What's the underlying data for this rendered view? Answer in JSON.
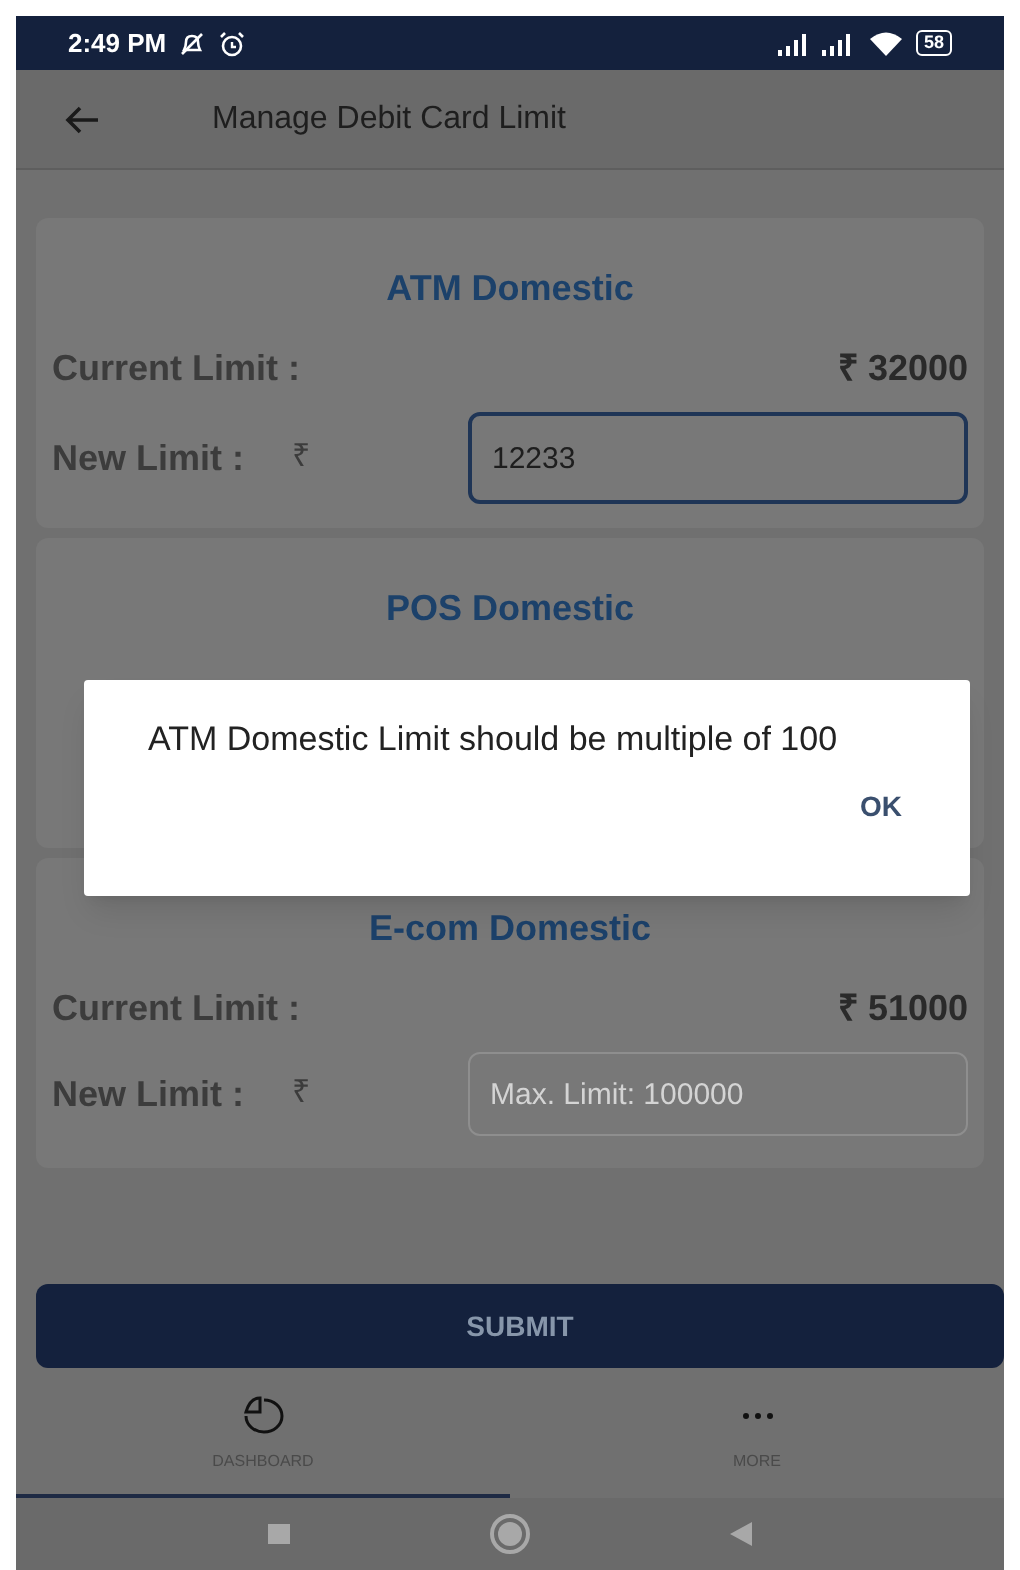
{
  "status_bar": {
    "time": "2:49 PM",
    "battery": "58"
  },
  "app_bar": {
    "title": "Manage Debit Card Limit"
  },
  "sections": [
    {
      "title": "ATM Domestic",
      "current_label": "Current Limit :",
      "current_value": "₹ 32000",
      "new_label": "New Limit :",
      "currency": "₹",
      "value": "12233",
      "focused": true
    },
    {
      "title": "POS Domestic"
    },
    {
      "title": "E-com Domestic",
      "current_label": "Current Limit :",
      "current_value": "₹ 51000",
      "new_label": "New Limit :",
      "currency": "₹",
      "placeholder": "Max. Limit: 100000",
      "focused": false
    }
  ],
  "dialog": {
    "message": "ATM Domestic Limit should be multiple of 100",
    "button": "OK"
  },
  "submit": "SUBMIT",
  "bottom_nav": [
    {
      "kind": "dashboard",
      "label": "DASHBOARD",
      "selected": true
    },
    {
      "kind": "more",
      "label": "MORE",
      "selected": false
    }
  ]
}
